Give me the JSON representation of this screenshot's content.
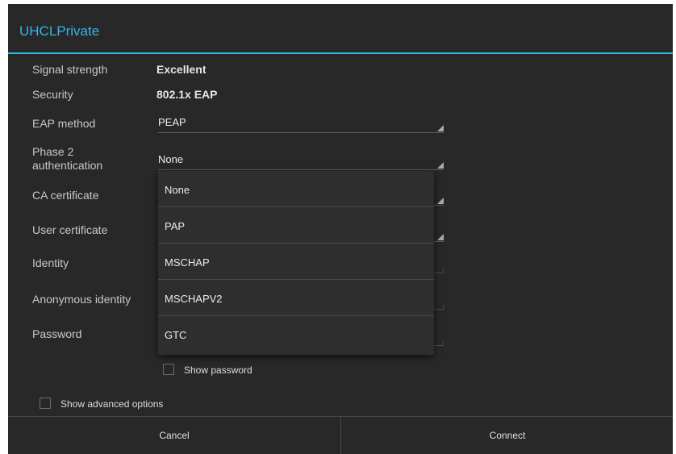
{
  "dialog": {
    "title": "UHCLPrivate",
    "signal_label": "Signal strength",
    "signal_value": "Excellent",
    "security_label": "Security",
    "security_value": "802.1x EAP",
    "eap_label": "EAP method",
    "eap_value": "PEAP",
    "phase2_label_line1": "Phase 2",
    "phase2_label_line2": "authentication",
    "phase2_value": "None",
    "ca_label": "CA certificate",
    "user_cert_label": "User certificate",
    "identity_label": "Identity",
    "anon_label": "Anonymous identity",
    "password_label": "Password",
    "show_password": "Show password",
    "show_advanced": "Show advanced options",
    "cancel": "Cancel",
    "connect": "Connect"
  },
  "dropdown": {
    "items": [
      "None",
      "PAP",
      "MSCHAP",
      "MSCHAPV2",
      "GTC"
    ]
  },
  "colors": {
    "accent": "#33b5e5",
    "background": "#282828"
  }
}
